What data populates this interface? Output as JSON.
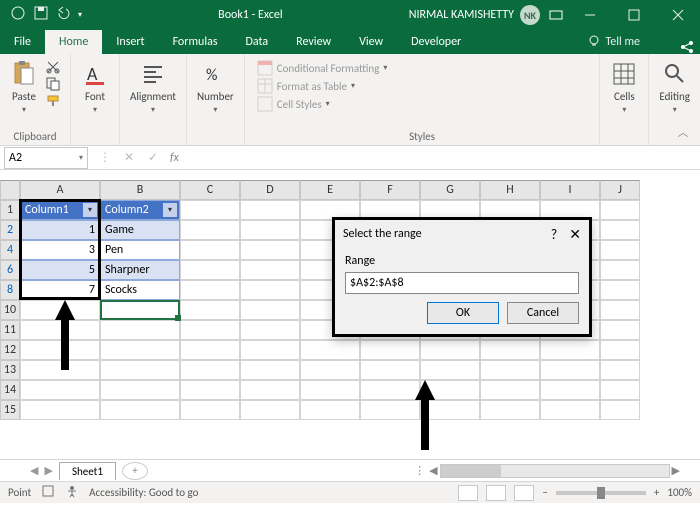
{
  "titlebar": {
    "title": "Book1 - Excel",
    "user_name": "NIRMAL KAMISHETTY",
    "user_initials": "NK"
  },
  "tabs": {
    "file": "File",
    "home": "Home",
    "insert": "Insert",
    "formulas": "Formulas",
    "data": "Data",
    "review": "Review",
    "view": "View",
    "developer": "Developer",
    "tellme": "Tell me"
  },
  "ribbon": {
    "clipboard": {
      "paste": "Paste",
      "label": "Clipboard"
    },
    "font": {
      "btn": "Font"
    },
    "alignment": {
      "btn": "Alignment"
    },
    "number": {
      "btn": "Number"
    },
    "styles": {
      "cond": "Conditional Formatting",
      "table": "Format as Table",
      "cell": "Cell Styles",
      "label": "Styles"
    },
    "cells": {
      "btn": "Cells"
    },
    "editing": {
      "btn": "Editing"
    }
  },
  "formulabar": {
    "namebox": "A2",
    "fx": "fx"
  },
  "columns": [
    "A",
    "B",
    "C",
    "D",
    "E",
    "F",
    "G",
    "H",
    "I",
    "J"
  ],
  "rows_visible": [
    "1",
    "2",
    "4",
    "6",
    "8",
    "10",
    "11",
    "12",
    "13",
    "14",
    "15"
  ],
  "table": {
    "headers": [
      "Column1",
      "Column2"
    ],
    "data": [
      {
        "c1": "1",
        "c2": "Game"
      },
      {
        "c1": "3",
        "c2": "Pen"
      },
      {
        "c1": "5",
        "c2": "Sharpner"
      },
      {
        "c1": "7",
        "c2": "Scocks"
      }
    ]
  },
  "dialog": {
    "title": "Select the range",
    "field_label": "Range",
    "value": "$A$2:$A$8",
    "ok": "OK",
    "cancel": "Cancel"
  },
  "sheettabs": {
    "sheet1": "Sheet1"
  },
  "statusbar": {
    "mode": "Point",
    "accessibility": "Accessibility: Good to go",
    "zoom": "100%"
  }
}
